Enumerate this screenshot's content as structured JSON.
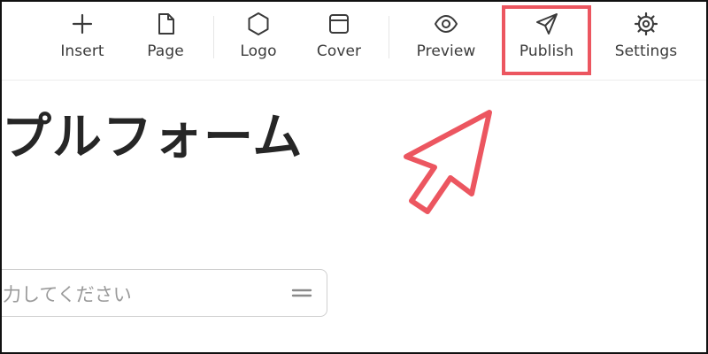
{
  "toolbar": {
    "items": [
      {
        "label": "Insert",
        "icon": "plus-icon"
      },
      {
        "label": "Page",
        "icon": "page-icon"
      },
      {
        "label": "Logo",
        "icon": "hexagon-icon"
      },
      {
        "label": "Cover",
        "icon": "cover-icon"
      },
      {
        "label": "Preview",
        "icon": "eye-icon"
      },
      {
        "label": "Publish",
        "icon": "send-icon"
      },
      {
        "label": "Settings",
        "icon": "gear-icon"
      }
    ]
  },
  "page": {
    "title": "プルフォーム"
  },
  "field": {
    "placeholder": "力してください",
    "handle_icon": "drag-handle-icon"
  },
  "annotation": {
    "color": "#ec5660",
    "highlight_target": "Publish",
    "pointer_icon": "cursor-arrow-icon"
  }
}
